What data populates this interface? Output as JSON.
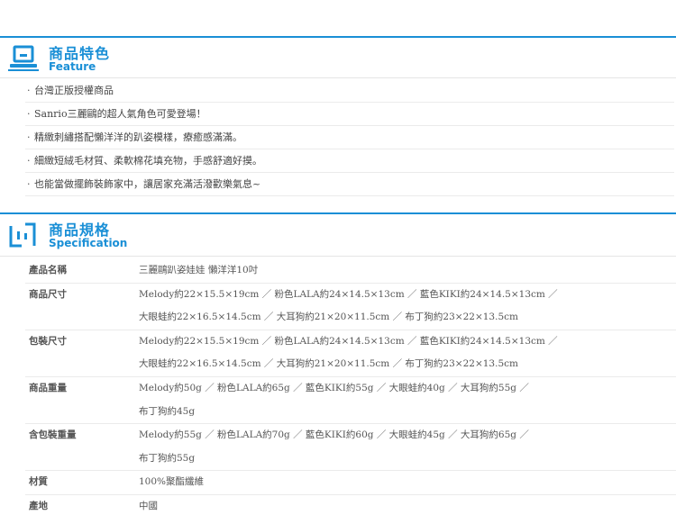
{
  "feature": {
    "title_zh": "商品特色",
    "title_en": "Feature",
    "icon": "laptop-icon",
    "items": [
      "台灣正版授權商品",
      "Sanrio三麗鷗的超人氣角色可愛登場！",
      "精緻刺繡搭配懶洋洋的趴姿模樣，療癒感滿滿。",
      "細緻短絨毛材質、柔軟棉花填充物，手感舒適好摸。",
      "也能當做擺飾裝飾家中，讓居家充滿活潑歡樂氣息~"
    ]
  },
  "spec": {
    "title_zh": "商品規格",
    "title_en": "Specification",
    "icon": "spec-icon",
    "rows": [
      {
        "label": "產品名稱",
        "lines": [
          "三麗鷗趴姿娃娃 懶洋洋10吋"
        ]
      },
      {
        "label": "商品尺寸",
        "lines": [
          "Melody約22×15.5×19cm ／ 粉色LALA約24×14.5×13cm ／ 藍色KIKI約24×14.5×13cm ／",
          "大眼蛙約22×16.5×14.5cm ／ 大耳狗約21×20×11.5cm ／ 布丁狗約23×22×13.5cm"
        ]
      },
      {
        "label": "包裝尺寸",
        "lines": [
          "Melody約22×15.5×19cm ／ 粉色LALA約24×14.5×13cm ／ 藍色KIKI約24×14.5×13cm ／",
          "大眼蛙約22×16.5×14.5cm ／ 大耳狗約21×20×11.5cm ／ 布丁狗約23×22×13.5cm"
        ]
      },
      {
        "label": "商品重量",
        "lines": [
          "Melody約50g ／ 粉色LALA約65g ／ 藍色KIKI約55g ／ 大眼蛙約40g ／ 大耳狗約55g ／",
          "布丁狗約45g"
        ]
      },
      {
        "label": "含包裝重量",
        "lines": [
          "Melody約55g ／ 粉色LALA約70g ／ 藍色KIKI約60g ／ 大眼蛙約45g ／ 大耳狗約65g ／",
          "布丁狗約55g"
        ]
      },
      {
        "label": "材質",
        "lines": [
          "100%聚酯纖維"
        ]
      },
      {
        "label": "產地",
        "lines": [
          "中國"
        ]
      }
    ]
  },
  "colors": {
    "accent": "#1a8fd6"
  }
}
